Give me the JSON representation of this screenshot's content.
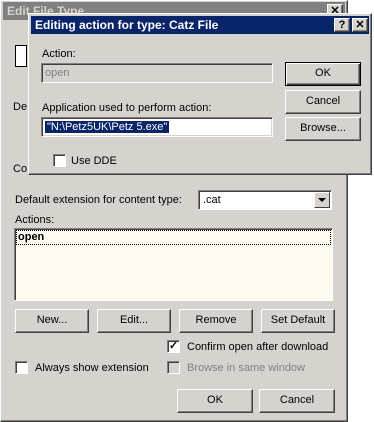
{
  "background_window": {
    "title": "Edit File Type",
    "partial_label_de": "De",
    "partial_label_co": "Co",
    "default_extension_label": "Default extension for content type:",
    "default_extension_value": ".cat",
    "actions_label": "Actions:",
    "actions": [
      "open"
    ],
    "buttons": {
      "new": "New...",
      "edit": "Edit...",
      "remove": "Remove",
      "set_default": "Set Default",
      "ok": "OK",
      "cancel": "Cancel"
    },
    "checkboxes": {
      "confirm_open": {
        "label": "Confirm open after download",
        "checked": true
      },
      "always_show_ext": {
        "label": "Always show extension",
        "checked": false
      },
      "browse_same_window": {
        "label": "Browse in same window",
        "checked": false,
        "disabled": true
      }
    }
  },
  "dialog": {
    "title": "Editing action for type: Catz File",
    "help_glyph": "?",
    "close_glyph": "✕",
    "action_label": "Action:",
    "action_value": "open",
    "app_label": "Application used to perform action:",
    "app_value": "\"N:\\Petz5UK\\Petz 5.exe\"",
    "use_dde_label": "Use DDE",
    "use_dde_checked": false,
    "buttons": {
      "ok": "OK",
      "cancel": "Cancel",
      "browse": "Browse..."
    }
  },
  "colors": {
    "window_face": "#d6d3ce",
    "title_active": "#0a246a",
    "title_inactive": "#808080",
    "list_background": "#fffbf0",
    "selection": "#0a246a"
  }
}
